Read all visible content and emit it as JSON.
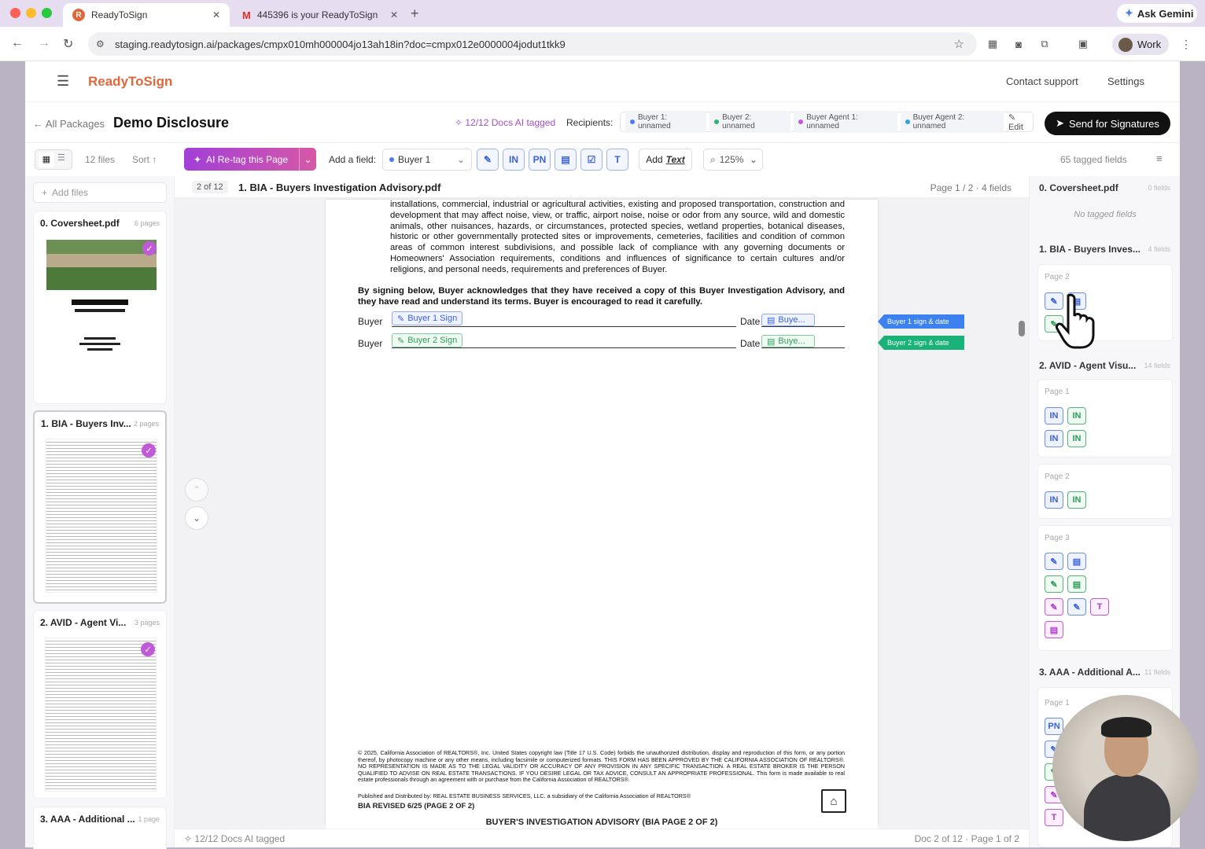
{
  "browser": {
    "tabs": [
      {
        "title": "ReadyToSign",
        "active": true
      },
      {
        "title": "445396 is your ReadyToSign",
        "active": false
      }
    ],
    "url": "staging.readytosign.ai/packages/cmpx010mh000004jo13ah18in?doc=cmpx012e0000004jodut1tkk9",
    "ask_gemini": "Ask Gemini",
    "profile": "Work"
  },
  "nav": {
    "brand": "ReadyToSign",
    "contact": "Contact support",
    "settings": "Settings"
  },
  "header": {
    "back": "All Packages",
    "title": "Demo Disclosure",
    "ai_tagged": "12/12 Docs AI tagged",
    "recipients_label": "Recipients:",
    "recipients": [
      {
        "name": "Buyer 1: unnamed",
        "color": "#4a7cf0"
      },
      {
        "name": "Buyer 2: unnamed",
        "color": "#2fb36b"
      },
      {
        "name": "Buyer Agent 1: unnamed",
        "color": "#c05ad6"
      },
      {
        "name": "Buyer Agent 2: unnamed",
        "color": "#2aa3d8"
      }
    ],
    "edit": "Edit",
    "send": "Send for Signatures"
  },
  "toolbar": {
    "files_count": "12 files",
    "sort": "Sort",
    "retag": "AI Re-tag this Page",
    "add_field_label": "Add a field:",
    "field_recipient": "Buyer 1",
    "tools": [
      "IN",
      "PN",
      "T"
    ],
    "add_text_a": "Add",
    "add_text_b": "Text",
    "zoom": "125%",
    "tagged_fields": "65 tagged fields"
  },
  "left": {
    "add_files": "Add files",
    "files": [
      {
        "name": "0. Coversheet.pdf",
        "pages": "6 pages"
      },
      {
        "name": "1. BIA - Buyers Inv...",
        "pages": "2 pages"
      },
      {
        "name": "2. AVID - Agent Vi...",
        "pages": "3 pages"
      },
      {
        "name": "3. AAA - Additional ...",
        "pages": "1 page"
      }
    ]
  },
  "doc": {
    "position": "2 of 12",
    "filename": "1. BIA - Buyers Investigation Advisory.pdf",
    "page_info": "Page 1 / 2 · 4 fields",
    "paragraph": "installations, commercial, industrial or agricultural activities, existing and proposed transportation, construction and development that may affect noise, view, or traffic, airport noise, noise or odor from any source, wild and domestic animals, other nuisances, hazards, or circumstances, protected species, wetland properties, botanical diseases, historic or other governmentally protected sites or improvements, cemeteries, facilities and condition of common areas of common interest subdivisions, and possible lack of compliance with any governing documents or Homeowners' Association requirements, conditions and influences of significance to certain cultures and/or religions, and personal needs, requirements and preferences of Buyer.",
    "acknowledge": "By signing below, Buyer acknowledges that they have received a copy of this Buyer Investigation Advisory, and they have read and understand its terms. Buyer is encouraged to read it carefully.",
    "buyer_label": "Buyer",
    "date_label": "Date",
    "sig1": "Buyer 1 Sign",
    "sig2": "Buyer 2 Sign",
    "date1": "Buye...",
    "date2": "Buye...",
    "tag1": "Buyer 1 sign & date",
    "tag2": "Buyer 2 sign & date",
    "copyright": "© 2025, California Association of REALTORS®, Inc. United States copyright law (Title 17 U.S. Code) forbids the unauthorized distribution, display and reproduction of this form, or any portion thereof, by photocopy machine or any other means, including facsimile or computerized formats. THIS FORM HAS BEEN APPROVED BY THE CALIFORNIA ASSOCIATION OF REALTORS®. NO REPRESENTATION IS MADE AS TO THE LEGAL VALIDITY OR ACCURACY OF ANY PROVISION IN ANY SPECIFIC TRANSACTION. A REAL ESTATE BROKER IS THE PERSON QUALIFIED TO ADVISE ON REAL ESTATE TRANSACTIONS. IF YOU DESIRE LEGAL OR TAX ADVICE, CONSULT AN APPROPRIATE PROFESSIONAL. This form is made available to real estate professionals through an agreement with or purchase from the California Association of REALTORS®.",
    "published": "Published and Distributed by: REAL ESTATE BUSINESS SERVICES, LLC. a subsidiary of the California Association of REALTORS®",
    "revised": "BIA REVISED 6/25 (PAGE 2 OF 2)",
    "footer_title": "BUYER'S INVESTIGATION ADVISORY (BIA PAGE 2 OF 2)",
    "status_left": "12/12 Docs AI tagged",
    "status_right": "Doc 2 of 12 · Page 1 of 2"
  },
  "right": {
    "sections": [
      {
        "name": "0. Coversheet.pdf",
        "count": "0 fields",
        "empty": "No tagged fields"
      },
      {
        "name": "1. BIA - Buyers Inves...",
        "count": "4 fields"
      },
      {
        "name": "2. AVID - Agent Visu...",
        "count": "14 fields"
      },
      {
        "name": "3. AAA - Additional A...",
        "count": "11 fields"
      }
    ],
    "page_labels": [
      "Page 2",
      "Page 1",
      "Page 2",
      "Page 3",
      "Page 1"
    ],
    "in": "IN",
    "pn": "PN",
    "t": "T"
  }
}
